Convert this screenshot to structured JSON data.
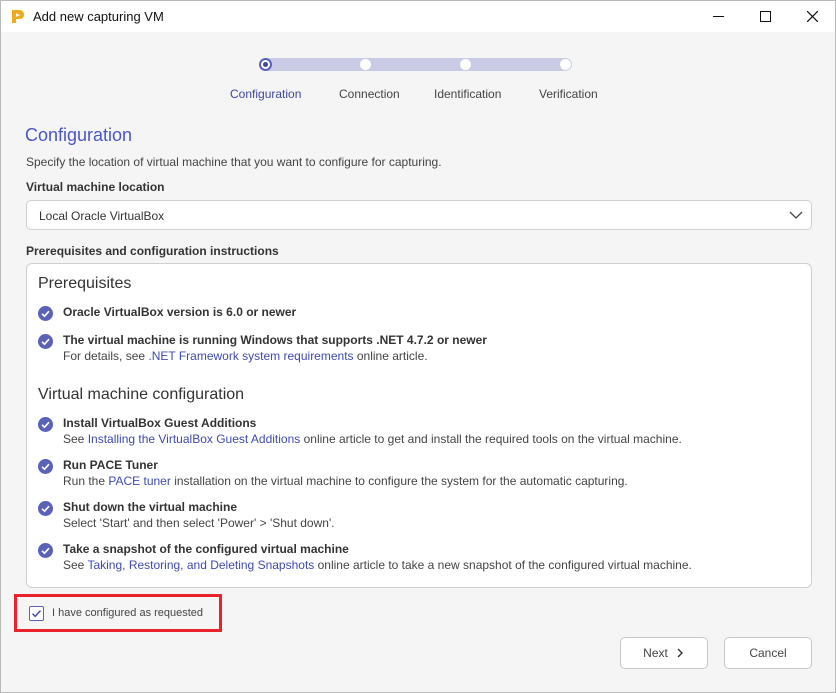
{
  "window": {
    "title": "Add new capturing VM"
  },
  "steps": [
    {
      "label": "Configuration",
      "active": true
    },
    {
      "label": "Connection",
      "active": false
    },
    {
      "label": "Identification",
      "active": false
    },
    {
      "label": "Verification",
      "active": false
    }
  ],
  "page": {
    "title": "Configuration",
    "subtitle": "Specify the location of virtual machine that you want to configure for capturing."
  },
  "location": {
    "label": "Virtual machine location",
    "selected": "Local Oracle VirtualBox"
  },
  "instructions": {
    "label": "Prerequisites and configuration instructions",
    "prereq_heading": "Prerequisites",
    "prereq_items": [
      {
        "title": "Oracle VirtualBox version is 6.0 or newer"
      },
      {
        "title": "The virtual machine is running Windows that supports .NET 4.7.2 or newer",
        "pre": "For details, see ",
        "link": ".NET Framework system requirements",
        "post": " online article."
      }
    ],
    "config_heading": "Virtual machine configuration",
    "config_items": [
      {
        "title": "Install VirtualBox Guest Additions",
        "pre": "See ",
        "link": "Installing the VirtualBox Guest Additions",
        "post": " online article to get and install the required tools on the virtual machine."
      },
      {
        "title": "Run PACE Tuner",
        "pre": "Run the ",
        "link": "PACE tuner",
        "post": " installation on the virtual machine to configure the system for the automatic capturing."
      },
      {
        "title": "Shut down the virtual machine",
        "pre": "Select 'Start' and then select 'Power' > 'Shut down'."
      },
      {
        "title": "Take a snapshot of the configured virtual machine",
        "pre": "See ",
        "link": "Taking, Restoring, and Deleting Snapshots",
        "post": " online article to take a new snapshot of the configured virtual machine."
      }
    ]
  },
  "confirm": {
    "label": "I have configured as requested",
    "checked": true
  },
  "buttons": {
    "next": "Next",
    "cancel": "Cancel"
  },
  "colors": {
    "accent": "#4a56c2",
    "highlight": "#e8232b",
    "app_icon": "#f0a81c"
  }
}
